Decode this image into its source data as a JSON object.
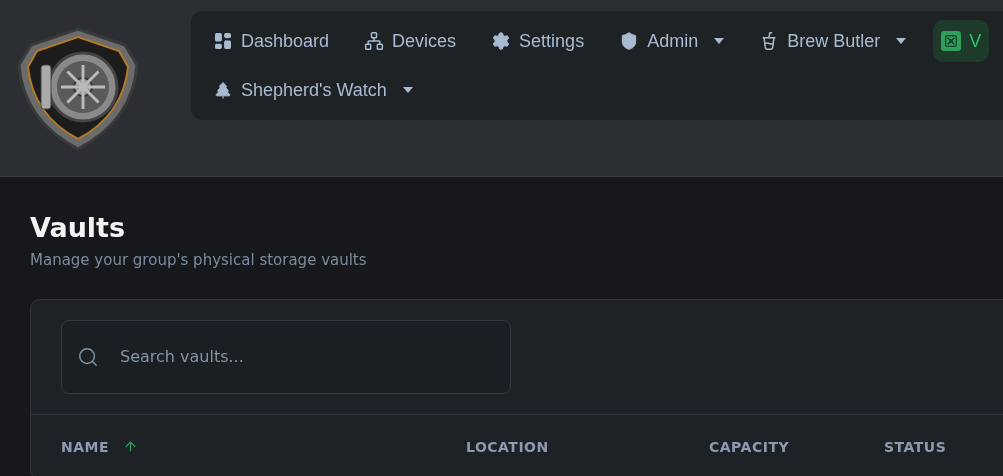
{
  "nav": {
    "rows": [
      [
        {
          "label": "Dashboard",
          "dropdown": false,
          "selected": false
        },
        {
          "label": "Devices",
          "dropdown": false,
          "selected": false
        },
        {
          "label": "Settings",
          "dropdown": false,
          "selected": false
        },
        {
          "label": "Admin",
          "dropdown": true,
          "selected": false
        },
        {
          "label": "Brew Butler",
          "dropdown": true,
          "selected": false
        },
        {
          "label": "V",
          "dropdown": false,
          "selected": true
        }
      ],
      [
        {
          "label": "Shepherd's Watch",
          "dropdown": true,
          "selected": false
        }
      ]
    ]
  },
  "page": {
    "title": "Vaults",
    "subtitle": "Manage your group's physical storage vaults"
  },
  "search": {
    "placeholder": "Search vaults..."
  },
  "table": {
    "columns": [
      {
        "label": "NAME",
        "sorted": true
      },
      {
        "label": "LOCATION",
        "sorted": false
      },
      {
        "label": "CAPACITY",
        "sorted": false
      },
      {
        "label": "STATUS",
        "sorted": false
      }
    ]
  }
}
